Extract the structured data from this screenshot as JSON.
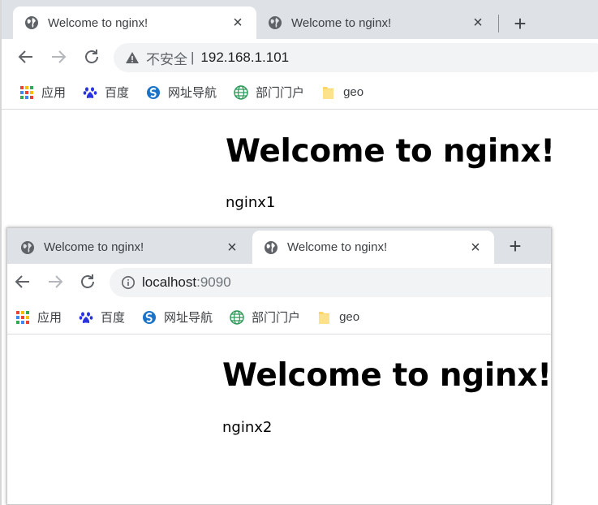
{
  "window1": {
    "tabs": [
      {
        "title": "Welcome to nginx!",
        "active": true
      },
      {
        "title": "Welcome to nginx!",
        "active": false
      }
    ],
    "address": {
      "security_text": "不安全",
      "separator": "|",
      "host": "192.168.1.101",
      "port": ""
    },
    "bookmarks": [
      "应用",
      "百度",
      "网址导航",
      "部门门户",
      "geo"
    ],
    "page": {
      "heading": "Welcome to nginx!",
      "body": "nginx1"
    }
  },
  "window2": {
    "tabs": [
      {
        "title": "Welcome to nginx!",
        "active": false
      },
      {
        "title": "Welcome to nginx!",
        "active": true
      }
    ],
    "address": {
      "host": "localhost",
      "port": ":9090"
    },
    "bookmarks": [
      "应用",
      "百度",
      "网址导航",
      "部门门户",
      "geo"
    ],
    "page": {
      "heading": "Welcome to nginx!",
      "body": "nginx2"
    }
  },
  "icons": {
    "tab_favicon": "globe-icon",
    "close": "close-icon",
    "new_tab": "plus-icon",
    "back": "back-arrow-icon",
    "forward": "forward-arrow-icon",
    "reload": "reload-icon",
    "not_secure": "warning-triangle-icon",
    "info": "info-icon",
    "apps": "apps-grid-icon",
    "baidu": "baidu-paw-icon",
    "sogou_nav": "sogou-icon",
    "portal": "globe-green-icon",
    "folder": "folder-icon"
  },
  "colors": {
    "tabstrip": "#dee1e6",
    "omnibox": "#f1f3f4",
    "text": "#202124"
  }
}
